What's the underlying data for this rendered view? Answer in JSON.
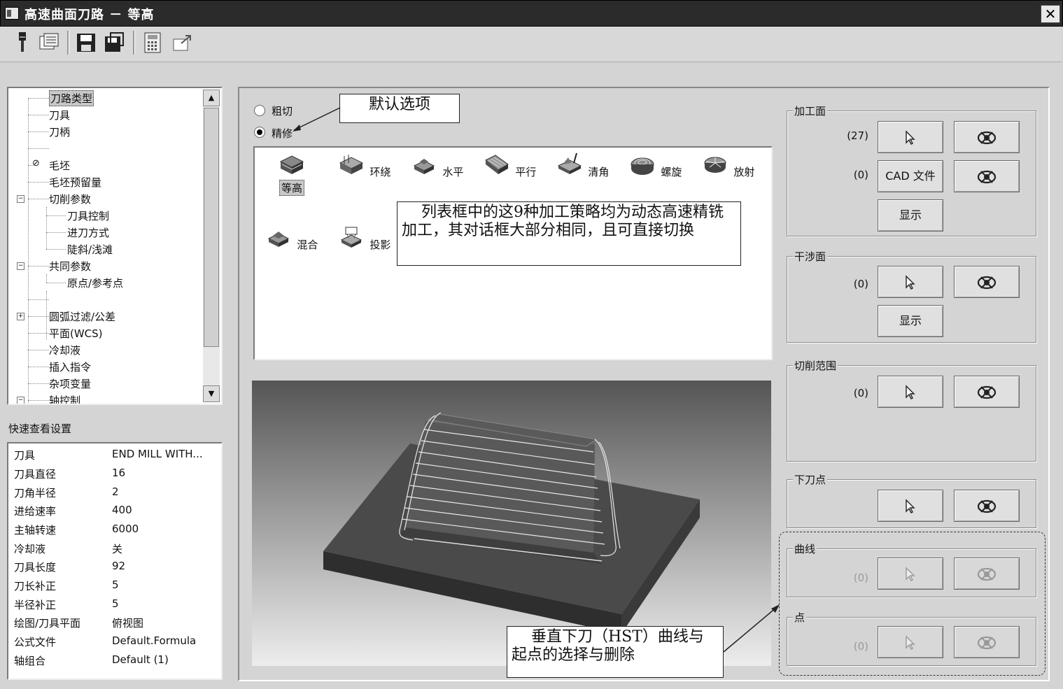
{
  "window": {
    "title": "高速曲面刀路 － 等高",
    "close_label": "✕"
  },
  "toolbar": {
    "buttons": [
      {
        "icon": "tool-pin-icon"
      },
      {
        "icon": "view-list-icon"
      },
      {
        "icon": "save-icon"
      },
      {
        "icon": "save-as-icon"
      },
      {
        "icon": "calculator-icon"
      },
      {
        "icon": "export-icon"
      }
    ]
  },
  "tree": {
    "items": [
      {
        "label": "刀路类型",
        "selected": true
      },
      {
        "label": "刀具"
      },
      {
        "label": "刀柄"
      },
      {
        "label": ""
      },
      {
        "label": "毛坯"
      },
      {
        "label": "毛坯预留量"
      },
      {
        "label": "切削参数"
      },
      {
        "label": "刀具控制"
      },
      {
        "label": "进刀方式"
      },
      {
        "label": "陡斜/浅滩"
      },
      {
        "label": "共同参数"
      },
      {
        "label": "原点/参考点"
      },
      {
        "label": ""
      },
      {
        "label": "圆弧过滤/公差"
      },
      {
        "label": "平面(WCS)"
      },
      {
        "label": "冷却液"
      },
      {
        "label": "插入指令"
      },
      {
        "label": "杂项变量"
      },
      {
        "label": "轴控制"
      }
    ]
  },
  "quick_settings": {
    "label": "快速查看设置",
    "rows": [
      {
        "key": "刀具",
        "value": "END MILL WITH..."
      },
      {
        "key": "刀具直径",
        "value": "16"
      },
      {
        "key": "刀角半径",
        "value": "2"
      },
      {
        "key": "进给速率",
        "value": "400"
      },
      {
        "key": "主轴转速",
        "value": "6000"
      },
      {
        "key": "冷却液",
        "value": "关"
      },
      {
        "key": "刀具长度",
        "value": "92"
      },
      {
        "key": "刀长补正",
        "value": "5"
      },
      {
        "key": "半径补正",
        "value": "5"
      },
      {
        "key": "绘图/刀具平面",
        "value": "俯视图"
      },
      {
        "key": "公式文件",
        "value": "Default.Formula"
      },
      {
        "key": "轴组合",
        "value": "Default (1)"
      }
    ]
  },
  "mode": {
    "rough_label": "粗切",
    "finish_label": "精修",
    "selected": "finish"
  },
  "strategies": [
    {
      "label": "等高",
      "icon": "contour-icon",
      "selected": true
    },
    {
      "label": "环绕",
      "icon": "scallop-icon"
    },
    {
      "label": "水平",
      "icon": "horizontal-icon"
    },
    {
      "label": "平行",
      "icon": "parallel-icon"
    },
    {
      "label": "清角",
      "icon": "pencil-icon"
    },
    {
      "label": "螺旋",
      "icon": "spiral-icon"
    },
    {
      "label": "放射",
      "icon": "radial-icon"
    },
    {
      "label": "混合",
      "icon": "hybrid-icon"
    },
    {
      "label": "投影",
      "icon": "project-icon"
    }
  ],
  "callouts": {
    "default_option": "默认选项",
    "strategies_note": "列表框中的这9种加工策略均为动态高速精铣加工，其对话框大部分相同，且可直接切换",
    "hst_note": "垂直下刀（HST）曲线与起点的选择与删除"
  },
  "groups": {
    "machining": {
      "title": "加工面",
      "count1": "(27)",
      "count2": "(0)",
      "cad_label": "CAD 文件",
      "show_label": "显示"
    },
    "check": {
      "title": "干涉面",
      "count": "(0)",
      "show_label": "显示"
    },
    "containment": {
      "title": "切削范围",
      "count": "(0)"
    },
    "entry": {
      "title": "下刀点"
    },
    "curve": {
      "title": "曲线",
      "count": "(0)"
    },
    "point": {
      "title": "点",
      "count": "(0)"
    }
  }
}
